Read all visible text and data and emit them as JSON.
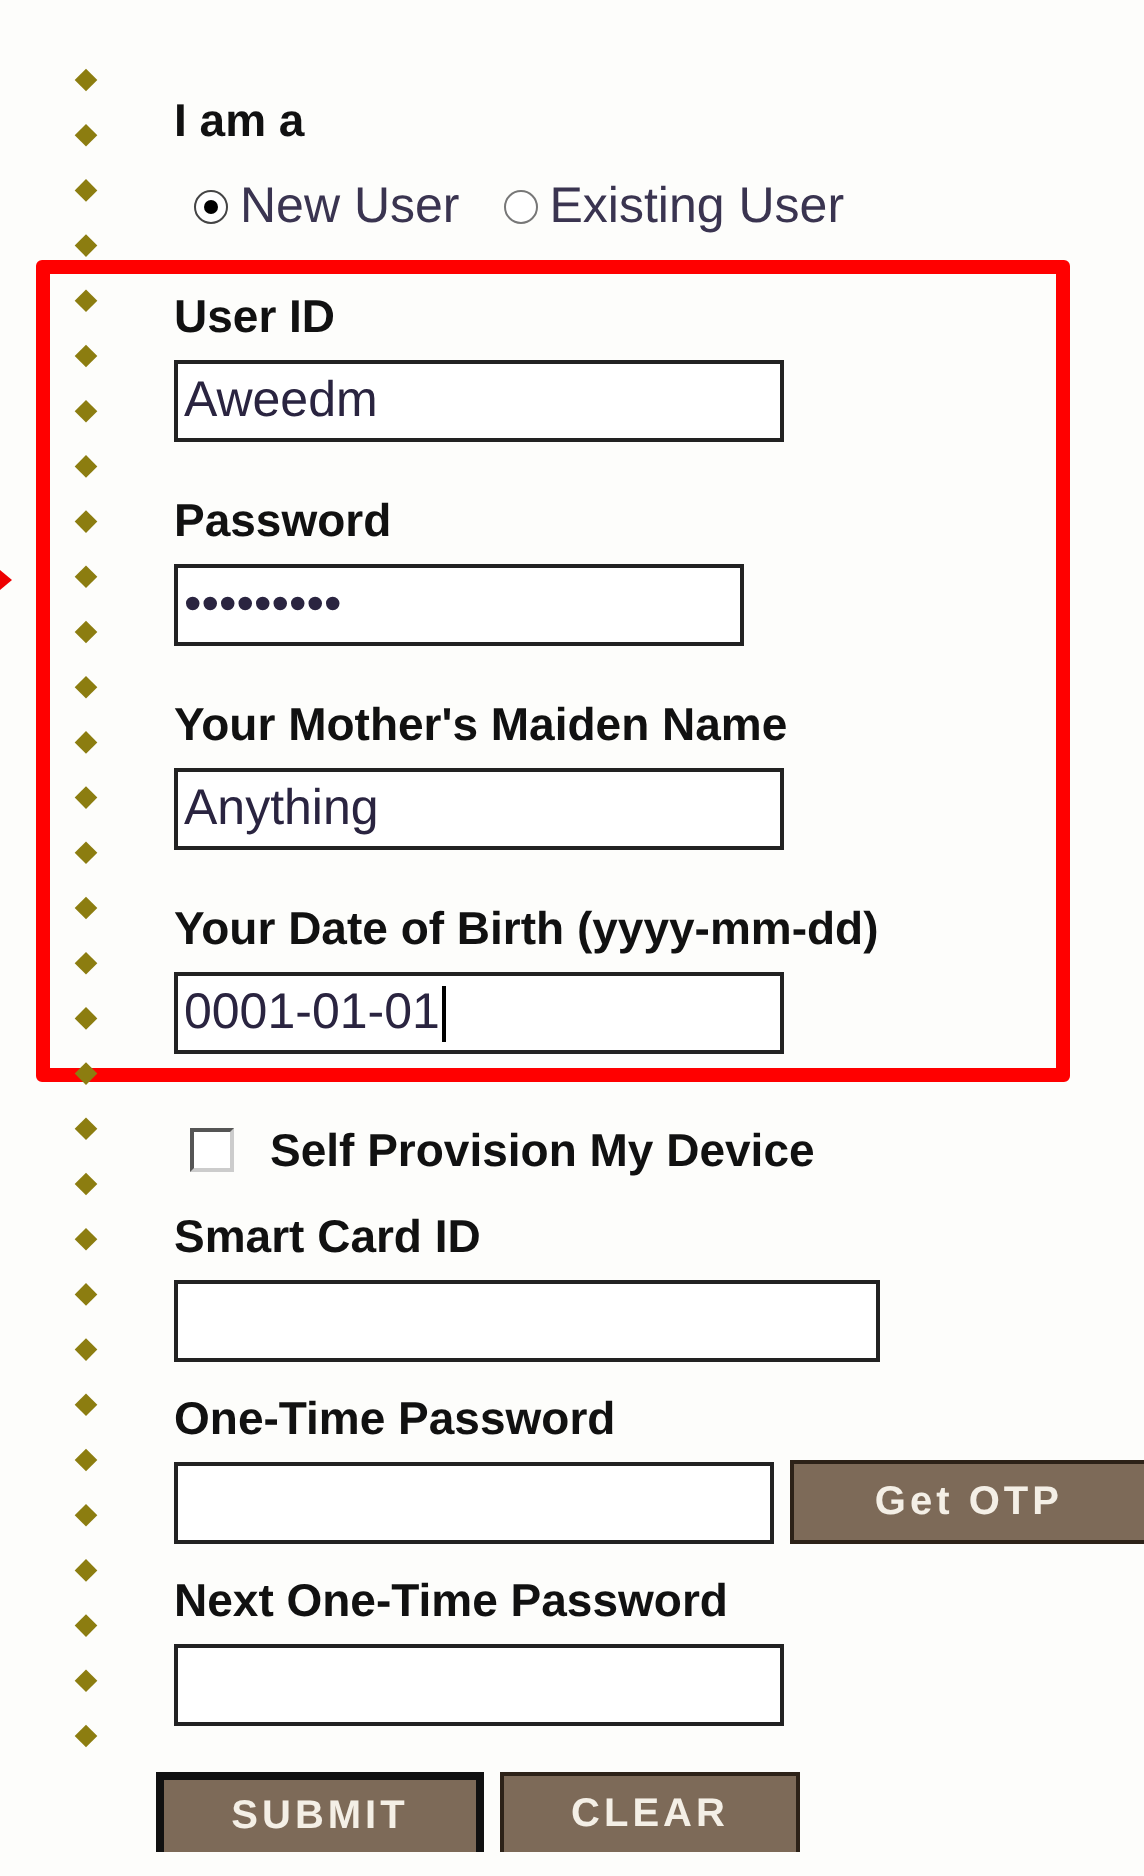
{
  "user_type": {
    "label": "I am a",
    "options": [
      {
        "label": "New User",
        "selected": true
      },
      {
        "label": "Existing User",
        "selected": false
      }
    ]
  },
  "highlighted_fields": [
    {
      "label": "User ID",
      "value": "Aweedm",
      "focused": false
    },
    {
      "label": "Password",
      "value": "•••••••••",
      "focused": false
    },
    {
      "label": "Your Mother's Maiden Name",
      "value": "Anything",
      "focused": false
    },
    {
      "label": "Your Date of Birth (yyyy-mm-dd)",
      "value": "0001-01-01",
      "focused": true
    }
  ],
  "self_provision": {
    "label": "Self Provision My Device",
    "checked": false
  },
  "fields": [
    {
      "label": "Smart Card ID"
    },
    {
      "label": "One-Time Password",
      "button": "Get OTP"
    },
    {
      "label": "Next One-Time Password"
    }
  ],
  "buttons": [
    {
      "label": "SUBMIT",
      "focused": true
    },
    {
      "label": "CLEAR",
      "focused": false
    }
  ]
}
